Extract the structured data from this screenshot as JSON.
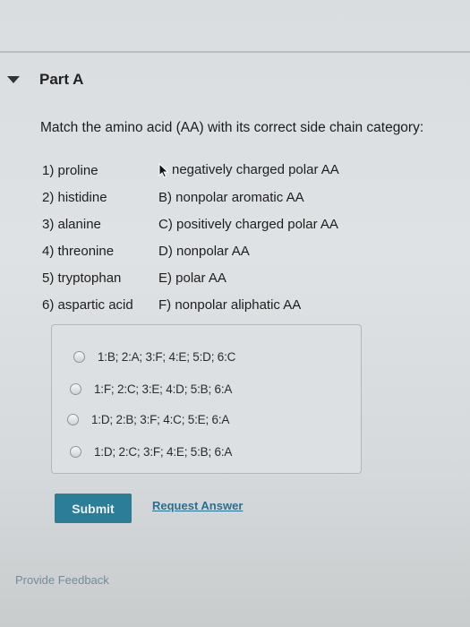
{
  "part": {
    "title": "Part A"
  },
  "question": "Match the amino acid (AA) with its correct side chain category:",
  "amino_acids": [
    "1) proline",
    "2) histidine",
    "3) alanine",
    "4) threonine",
    "5) tryptophan",
    "6) aspartic acid"
  ],
  "categories": [
    "negatively charged polar AA",
    "B) nonpolar aromatic AA",
    "C) positively charged polar AA",
    "D) nonpolar AA",
    "E) polar AA",
    "F) nonpolar aliphatic AA"
  ],
  "choices": [
    "1:B; 2:A; 3:F; 4:E; 5:D; 6:C",
    "1:F; 2:C; 3:E; 4:D; 5:B; 6:A",
    "1:D; 2:B; 3:F; 4:C; 5:E; 6:A",
    "1:D; 2:C; 3:F; 4:E; 5:B; 6:A"
  ],
  "actions": {
    "submit_label": "Submit",
    "request_answer_label": "Request Answer",
    "feedback_label": "Provide Feedback"
  }
}
